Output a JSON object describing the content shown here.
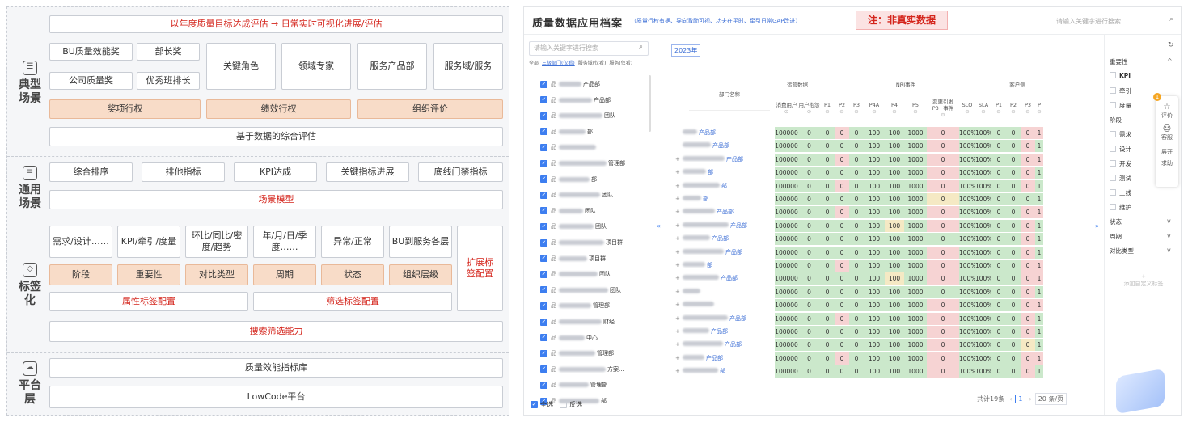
{
  "left": {
    "sections": [
      {
        "label": "典型\n场景",
        "icon": "badge-icon"
      },
      {
        "label": "通用\n场景",
        "icon": "list-icon"
      },
      {
        "label": "标签\n化",
        "icon": "tag-icon"
      },
      {
        "label": "平台\n层",
        "icon": "cloud-icon"
      }
    ],
    "typical": {
      "banner": "以年度质量目标达成评估 → 日常实时可视化进展/评估",
      "awards": [
        "BU质量效能奖",
        "部长奖",
        "公司质量奖",
        "优秀班排长"
      ],
      "roles": [
        "关键角色",
        "领域专家",
        "服务产品部",
        "服务域/服务"
      ],
      "rights": [
        "奖项行权",
        "绩效行权",
        "组织评价"
      ],
      "basis": "基于数据的综合评估"
    },
    "general": {
      "items": [
        "综合排序",
        "排他指标",
        "KPI达成",
        "关键指标进展",
        "底线门禁指标"
      ],
      "model": "场景模型"
    },
    "tagging": {
      "top": [
        "需求/设计……",
        "KPI/牵引/度量",
        "环比/同比/密度/趋势",
        "年/月/日/季度……",
        "异常/正常",
        "BU到服务各层"
      ],
      "mid": [
        "阶段",
        "重要性",
        "对比类型",
        "周期",
        "状态",
        "组织层级"
      ],
      "attr": "属性标签配置",
      "filter": "筛选标签配置",
      "ext": "扩展标签配置",
      "search": "搜索筛选能力"
    },
    "platform": {
      "lib": "质量效能指标库",
      "lowcode": "LowCode平台"
    }
  },
  "right": {
    "title": "质量数据应用档案",
    "subtitle": "（质量行权有据、导向激励可视、功夫在平时、牵引日常GAP改进）",
    "note": "注：非真实数据",
    "search_placeholder": "请输入关键字进行搜索",
    "tree": {
      "search_placeholder": "请输入关键字进行搜索",
      "tabs": [
        "全部",
        "三级部门(仅看)",
        "服务域(仅看)",
        "服务(仅看)"
      ],
      "suffixes": [
        "产品部",
        "产品部",
        "团队",
        "部",
        "",
        "管理部",
        "部",
        "团队",
        "团队",
        "团队",
        "项目群",
        "项目群",
        "团队",
        "团队",
        "管理部",
        "财经...",
        "中心",
        "管理部",
        "方案...",
        "管理部",
        "部"
      ],
      "select_all": "全选",
      "invert": "反选"
    },
    "year": "2023年",
    "table": {
      "dept_header": "部门名称",
      "groups": [
        "运营数据",
        "NRI事件",
        "客户侧"
      ],
      "cols": [
        "消费用户",
        "用户抱怨",
        "P1",
        "P2",
        "P3",
        "P4A",
        "P4",
        "P5",
        "变更引发P3+事件",
        "SLO",
        "SLA",
        "P1",
        "P2",
        "P3",
        "P"
      ],
      "depts": [
        "产品部",
        "产品部",
        "产品部",
        "部",
        "部",
        "部",
        "产品部",
        "产品部",
        "产品部",
        "产品部",
        "部",
        "产品部",
        "",
        "",
        "产品部",
        "产品部",
        "产品部",
        "产品部",
        "部"
      ],
      "values": [
        "100000",
        "0",
        "0",
        "0",
        "0",
        "100",
        "100",
        "1000",
        "0",
        "100%",
        "100%",
        "0",
        "0",
        "0",
        "1"
      ]
    },
    "pager": {
      "total": "共计19条",
      "page": "1",
      "size": "20 条/页"
    },
    "filters": {
      "importance": "重要性",
      "importance_items": [
        "KPI",
        "牵引",
        "度量"
      ],
      "stage": "阶段",
      "stage_items": [
        "需求",
        "设计",
        "开发",
        "测试",
        "上线",
        "维护"
      ],
      "status": "状态",
      "period": "周期",
      "compare": "对比类型",
      "add": "添加自定义标签"
    },
    "float": {
      "rate": "评价",
      "service": "客服",
      "expand": "展开",
      "help": "求助"
    }
  }
}
